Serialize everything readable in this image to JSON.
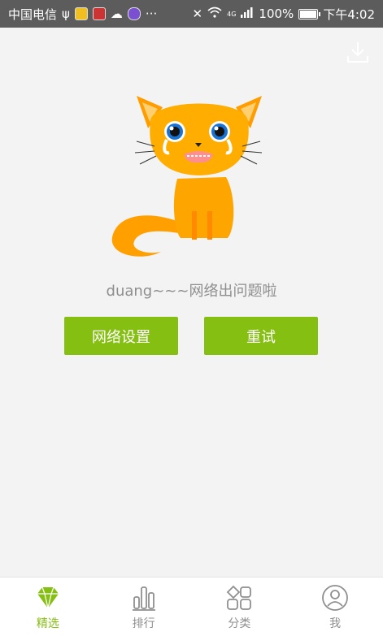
{
  "status_bar": {
    "carrier": "中国电信",
    "network": "4G",
    "battery": "100%",
    "time": "下午4:02"
  },
  "error": {
    "message": "duang~~~网络出问题啦"
  },
  "buttons": {
    "network_settings": "网络设置",
    "retry": "重试"
  },
  "tabs": [
    {
      "label": "精选",
      "icon": "diamond-icon",
      "active": true
    },
    {
      "label": "排行",
      "icon": "bar-chart-icon",
      "active": false
    },
    {
      "label": "分类",
      "icon": "category-grid-icon",
      "active": false
    },
    {
      "label": "我",
      "icon": "user-icon",
      "active": false
    }
  ],
  "colors": {
    "accent": "#85bf12",
    "status_bar": "#5c5c5c",
    "background": "#f3f3f3",
    "cat": "#ffa500"
  }
}
